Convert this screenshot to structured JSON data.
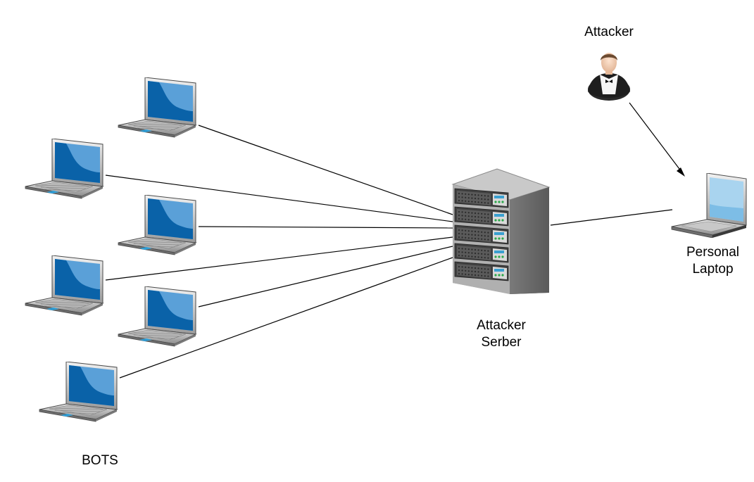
{
  "labels": {
    "attacker": "Attacker",
    "server_line1": "Attacker",
    "server_line2": "Serber",
    "laptop_line1": "Personal",
    "laptop_line2": "Laptop",
    "bots": "BOTS"
  },
  "icons": {
    "bot": "laptop-icon",
    "server": "server-rack-icon",
    "attacker": "person-icon",
    "personal": "laptop-icon"
  },
  "colors": {
    "screen_blue": "#0a62a8",
    "screen_light": "#5aa0d8",
    "personal_screen": "#a9d4ef",
    "server_body": "#6b6b6b",
    "line": "#000000"
  }
}
